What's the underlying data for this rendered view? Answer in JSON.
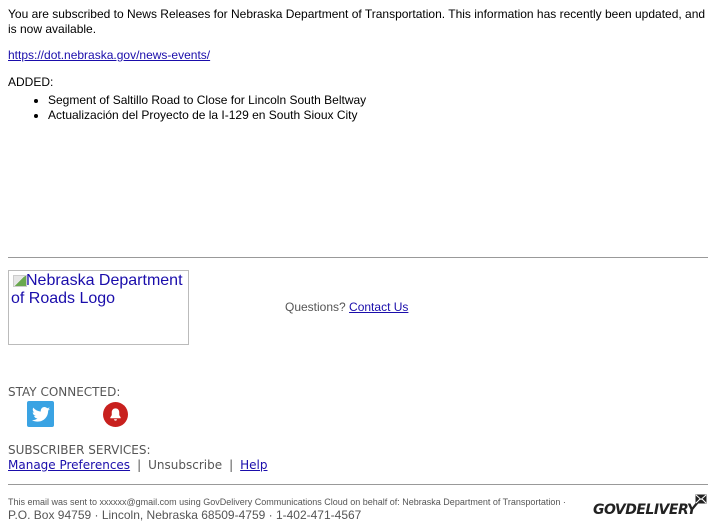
{
  "intro": "You are subscribed to News Releases for Nebraska Department of Transportation. This information has recently been updated, and is now available.",
  "main_link": "https://dot.nebraska.gov/news-events/",
  "added_label": "ADDED:",
  "items": [
    "Segment of Saltillo Road to Close for Lincoln South Beltway",
    "Actualización del Proyecto de la I-129 en South Sioux City"
  ],
  "logo_alt": "Nebraska Department of Roads Logo",
  "questions": {
    "label": "Questions?",
    "link": "Contact Us"
  },
  "stay_connected": {
    "label": "STAY CONNECTED:",
    "icons": [
      "twitter-icon",
      "bell-icon"
    ]
  },
  "subscriber_services": {
    "label": "SUBSCRIBER SERVICES:",
    "manage": "Manage Preferences",
    "unsubscribe": "Unsubscribe",
    "help": "Help",
    "separator": "|"
  },
  "footer": {
    "line1": "This email was sent to xxxxxx@gmail.com using GovDelivery Communications Cloud on behalf of: Nebraska Department of Transportation ·",
    "address": "P.O. Box 94759 · Lincoln, Nebraska 68509-4759 · 1-402-471-4567",
    "brand": "GOVDELIVERY"
  },
  "colors": {
    "link": "#1a0dab",
    "twitter": "#3aa3e3",
    "bell": "#c8201e"
  }
}
